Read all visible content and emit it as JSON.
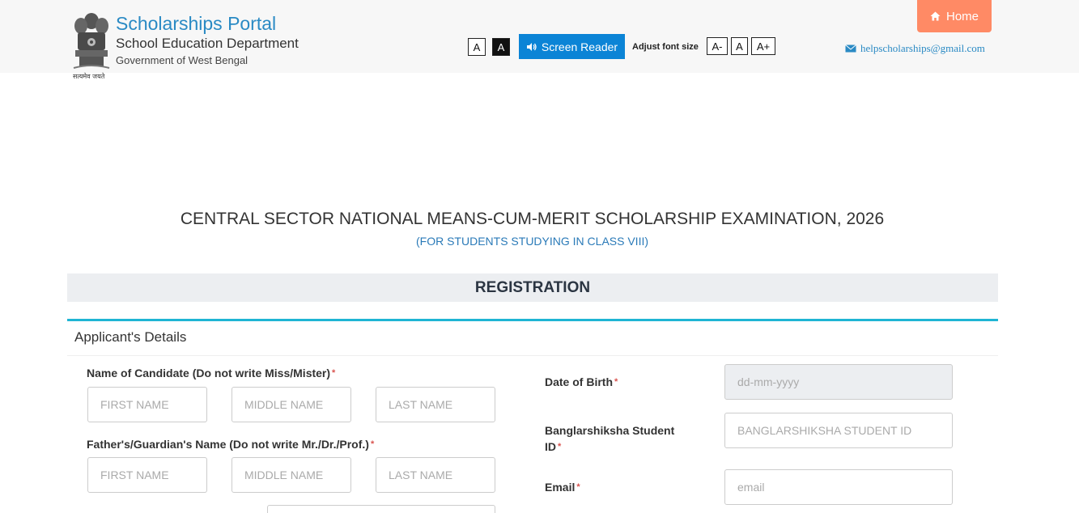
{
  "header": {
    "portal_title": "Scholarships Portal",
    "department": "School Education Department",
    "government": "Government of West Bengal",
    "emblem_caption": "सत्यमेव जयते",
    "contrast_light": "A",
    "contrast_dark": "A",
    "screen_reader": "Screen Reader",
    "adjust_font_label": "Adjust font size",
    "font_decrease": "A-",
    "font_normal": "A",
    "font_increase": "A+",
    "home": "Home",
    "help_email": "helpscholarships@gmail.com"
  },
  "exam": {
    "title": "CENTRAL SECTOR NATIONAL MEANS-CUM-MERIT SCHOLARSHIP EXAMINATION, 2026",
    "subtitle": "(FOR STUDENTS STUDYING IN CLASS VIII)"
  },
  "registration": {
    "heading": "REGISTRATION",
    "panel_title": "Applicant's Details"
  },
  "form": {
    "candidate_name": {
      "label": "Name of Candidate (Do not write Miss/Mister)",
      "first_placeholder": "FIRST NAME",
      "middle_placeholder": "MIDDLE NAME",
      "last_placeholder": "LAST NAME"
    },
    "guardian_name": {
      "label": "Father's/Guardian's Name (Do not write Mr./Dr./Prof.)",
      "first_placeholder": "FIRST NAME",
      "middle_placeholder": "MIDDLE NAME",
      "last_placeholder": "LAST NAME"
    },
    "dob": {
      "label": "Date of Birth",
      "placeholder": "dd-mm-yyyy"
    },
    "student_id": {
      "label_line1": "Banglarshiksha Student",
      "label_line2": "ID",
      "placeholder": "BANGLARSHIKSHA STUDENT ID"
    },
    "email": {
      "label": "Email",
      "placeholder": "email"
    },
    "required_marker": "*"
  },
  "colors": {
    "brand_blue": "#2a8ac4",
    "home_orange": "#ff8a65",
    "screen_reader_blue": "#0b84d6",
    "panel_accent": "#1fb5d4",
    "required_red": "#d9534f"
  }
}
